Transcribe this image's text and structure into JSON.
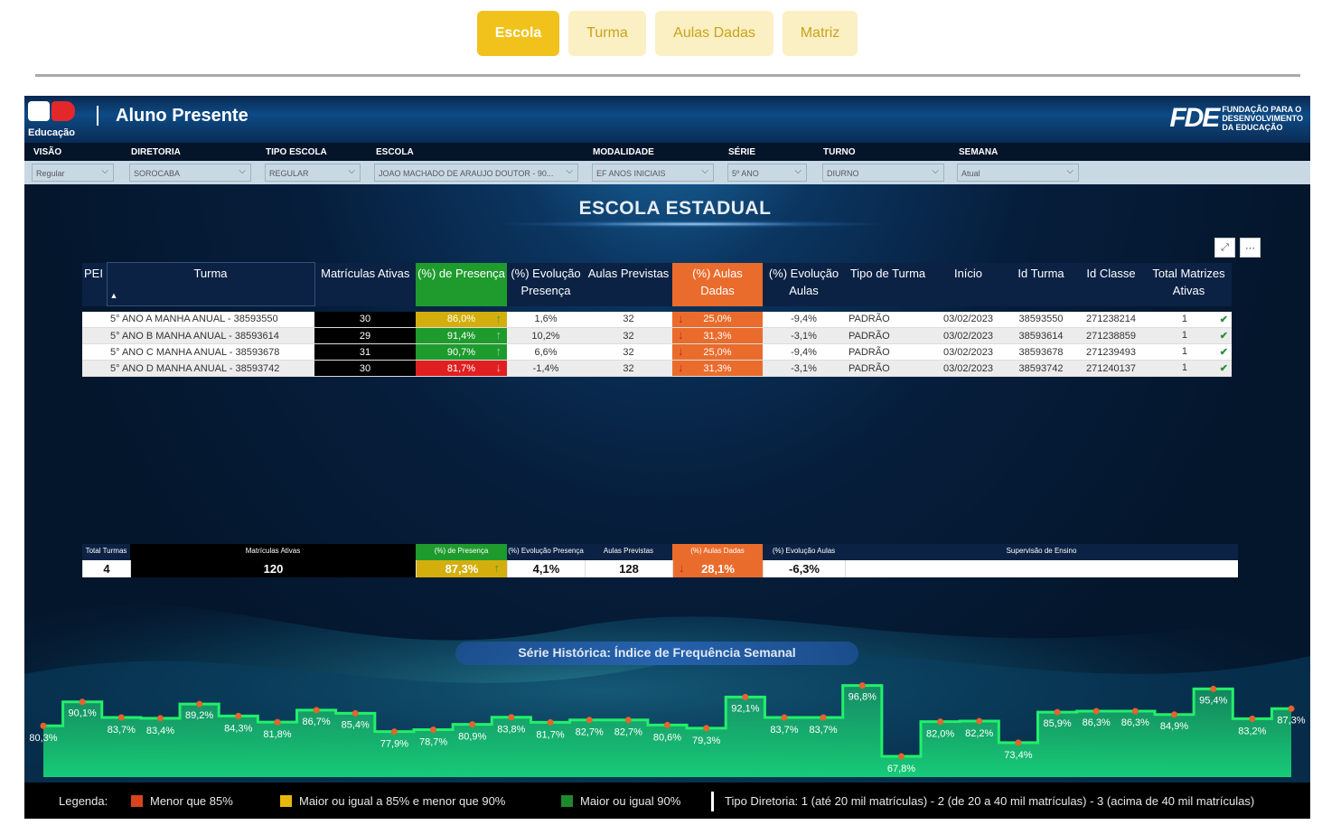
{
  "nav": {
    "tabs": [
      "Escola",
      "Turma",
      "Aulas Dadas",
      "Matriz"
    ],
    "active_tab": "Escola"
  },
  "header": {
    "logo_text": "Educação",
    "title": "Aluno Presente",
    "fde_mark": "FDE",
    "fde_line1": "FUNDAÇÃO PARA O",
    "fde_line2": "DESENVOLVIMENTO",
    "fde_line3": "DA EDUCAÇÃO"
  },
  "filters": {
    "labels": [
      "VISÃO",
      "DIRETORIA",
      "TIPO ESCOLA",
      "ESCOLA",
      "MODALIDADE",
      "SÉRIE",
      "TURNO",
      "SEMANA"
    ],
    "values": [
      "Regular",
      "SOROCABA",
      "REGULAR",
      "JOAO MACHADO DE ARAUJO DOUTOR - 90...",
      "EF ANOS INICIAIS",
      "5º ANO",
      "DIURNO",
      "Atual"
    ]
  },
  "school_title": "ESCOLA ESTADUAL",
  "table": {
    "headers": {
      "pei": "PEI",
      "turma": "Turma",
      "matriculas": "Matrículas Ativas",
      "presenca": "(%) de Presença",
      "evol_presenca": "(%) Evolução Presença",
      "aulas_previstas": "Aulas Previstas",
      "aulas_dadas": "(%) Aulas Dadas",
      "evol_aulas": "(%) Evolução Aulas",
      "tipo_turma": "Tipo de Turma",
      "inicio": "Início",
      "id_turma": "Id Turma",
      "id_classe": "Id Classe",
      "total_matrizes": "Total Matrizes Ativas"
    },
    "rows": [
      {
        "pei": "",
        "turma": "5° ANO A MANHA ANUAL - 38593550",
        "matriculas": "30",
        "presenca": "86,0%",
        "presenca_status": "yellow",
        "presenca_arrow": "up",
        "evol_presenca": "1,6%",
        "aulas_previstas": "32",
        "aulas_dadas": "25,0%",
        "evol_aulas": "-9,4%",
        "tipo_turma": "PADRÃO",
        "inicio": "03/02/2023",
        "id_turma": "38593550",
        "id_classe": "271238214",
        "total_matrizes": "1"
      },
      {
        "pei": "",
        "turma": "5° ANO B MANHA ANUAL - 38593614",
        "matriculas": "29",
        "presenca": "91,4%",
        "presenca_status": "green",
        "presenca_arrow": "up",
        "evol_presenca": "10,2%",
        "aulas_previstas": "32",
        "aulas_dadas": "31,3%",
        "evol_aulas": "-3,1%",
        "tipo_turma": "PADRÃO",
        "inicio": "03/02/2023",
        "id_turma": "38593614",
        "id_classe": "271238859",
        "total_matrizes": "1"
      },
      {
        "pei": "",
        "turma": "5° ANO C MANHA ANUAL - 38593678",
        "matriculas": "31",
        "presenca": "90,7%",
        "presenca_status": "green",
        "presenca_arrow": "up",
        "evol_presenca": "6,6%",
        "aulas_previstas": "32",
        "aulas_dadas": "25,0%",
        "evol_aulas": "-9,4%",
        "tipo_turma": "PADRÃO",
        "inicio": "03/02/2023",
        "id_turma": "38593678",
        "id_classe": "271239493",
        "total_matrizes": "1"
      },
      {
        "pei": "",
        "turma": "5° ANO D MANHA ANUAL - 38593742",
        "matriculas": "30",
        "presenca": "81,7%",
        "presenca_status": "red",
        "presenca_arrow": "down",
        "evol_presenca": "-1,4%",
        "aulas_previstas": "32",
        "aulas_dadas": "31,3%",
        "evol_aulas": "-3,1%",
        "tipo_turma": "PADRÃO",
        "inicio": "03/02/2023",
        "id_turma": "38593742",
        "id_classe": "271240137",
        "total_matrizes": "1"
      }
    ]
  },
  "summary": {
    "headers": {
      "total_turmas": "Total Turmas",
      "matriculas": "Matrículas Ativas",
      "presenca": "(%) de Presença",
      "evol_presenca": "(%) Evolução Presença",
      "aulas_previstas": "Aulas Previstas",
      "aulas_dadas": "(%) Aulas Dadas",
      "evol_aulas": "(%) Evolução Aulas",
      "supervisao": "Supervisão de Ensino"
    },
    "values": {
      "total_turmas": "4",
      "matriculas": "120",
      "presenca": "87,3%",
      "evol_presenca": "4,1%",
      "aulas_previstas": "128",
      "aulas_dadas": "28,1%",
      "evol_aulas": "-6,3%",
      "supervisao": ""
    }
  },
  "chart_title": "Série Histórica: Índice de Frequência Semanal",
  "chart_data": {
    "type": "area",
    "title": "Série Histórica: Índice de Frequência Semanal",
    "ylim": [
      60,
      100
    ],
    "grid": false,
    "series": [
      {
        "values": [
          80.3,
          90.1,
          83.7,
          83.4,
          89.2,
          84.3,
          81.8,
          86.7,
          85.4,
          77.9,
          78.7,
          80.9,
          83.8,
          81.7,
          82.7,
          82.7,
          80.6,
          79.3,
          92.1,
          83.7,
          83.7,
          96.8,
          67.8,
          82.0,
          82.2,
          73.4,
          85.9,
          86.3,
          86.3,
          84.9,
          95.4,
          83.2,
          87.3
        ],
        "labels": [
          "80,3%",
          "90,1%",
          "83,7%",
          "83,4%",
          "89,2%",
          "84,3%",
          "81,8%",
          "86,7%",
          "85,4%",
          "77,9%",
          "78,7%",
          "80,9%",
          "83,8%",
          "81,7%",
          "82,7%",
          "82,7%",
          "80,6%",
          "79,3%",
          "92,1%",
          "83,7%",
          "83,7%",
          "96,8%",
          "67,8%",
          "82,0%",
          "82,2%",
          "73,4%",
          "85,9%",
          "86,3%",
          "86,3%",
          "84,9%",
          "95,4%",
          "83,2%",
          "87,3%"
        ]
      }
    ]
  },
  "legend": {
    "label": "Legenda:",
    "items": [
      {
        "text": "Menor que 85%",
        "color": "#d9441c"
      },
      {
        "text": "Maior ou igual a 85% e menor que 90%",
        "color": "#e5b80b"
      },
      {
        "text": "Maior ou igual 90%",
        "color": "#1e8a2e"
      }
    ],
    "tipo_diretoria": "Tipo Diretoria: 1 (até 20 mil matrículas) - 2 (de 20 a 40 mil matrículas) - 3 (acima de 40 mil matrículas)"
  }
}
